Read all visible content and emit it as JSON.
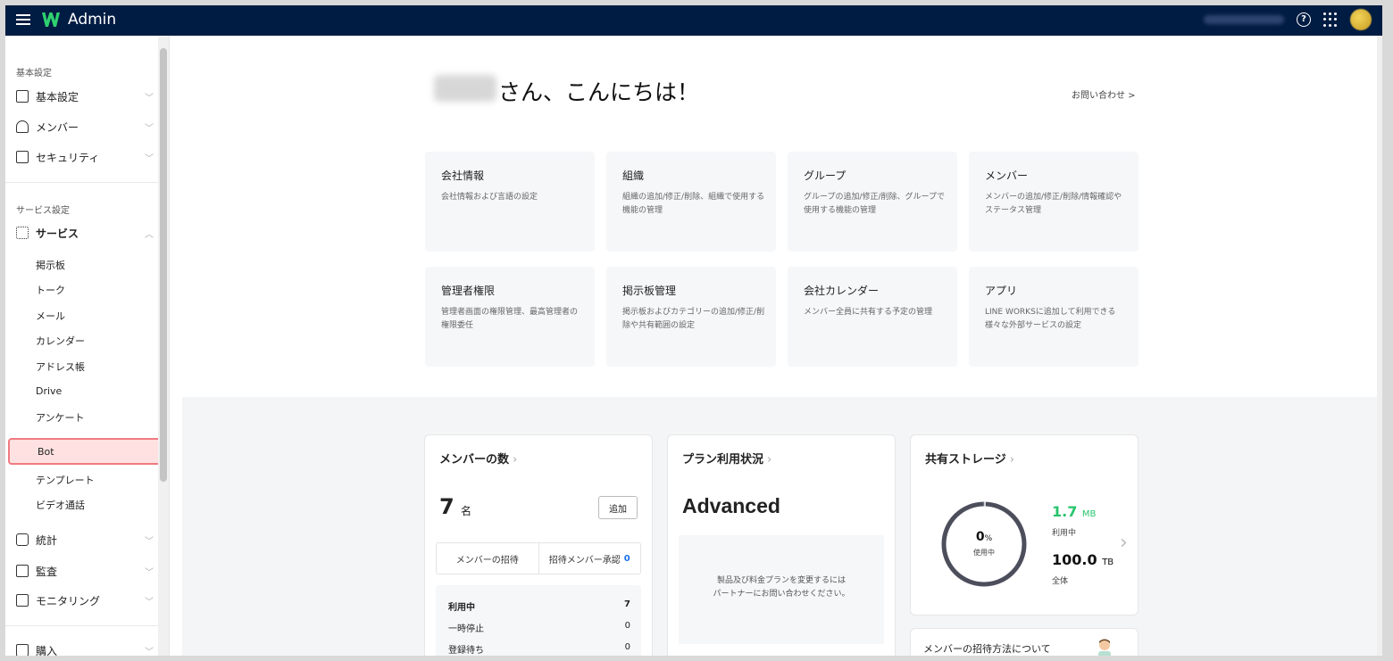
{
  "app": {
    "title": "Admin",
    "brand_color": "#001c43",
    "accent": "#27c46b",
    "highlight": "#ef7b82"
  },
  "sidebar": {
    "section_basic": "基本設定",
    "section_service": "サービス設定",
    "items": [
      {
        "label": "基本設定",
        "icon": "building-icon"
      },
      {
        "label": "メンバー",
        "icon": "members-icon"
      },
      {
        "label": "セキュリティ",
        "icon": "lock-icon"
      },
      {
        "label": "サービス",
        "icon": "apps-icon"
      },
      {
        "label": "統計",
        "icon": "chart-icon"
      },
      {
        "label": "監査",
        "icon": "audit-icon"
      },
      {
        "label": "モニタリング",
        "icon": "monitor-icon"
      },
      {
        "label": "購入",
        "icon": "wallet-icon"
      }
    ],
    "sub_items": [
      "掲示板",
      "トーク",
      "メール",
      "カレンダー",
      "アドレス帳",
      "Drive",
      "アンケート",
      "Bot",
      "テンプレート",
      "ビデオ通話"
    ],
    "active_sub": "Bot"
  },
  "main": {
    "greeting": "さん、こんにちは！",
    "contact": "お問い合わせ >",
    "cards": [
      {
        "title": "会社情報",
        "desc": "会社情報および言語の設定"
      },
      {
        "title": "組織",
        "desc": "組織の追加/修正/削除、組織で使用する機能の管理"
      },
      {
        "title": "グループ",
        "desc": "グループの追加/修正/削除、グループで使用する機能の管理"
      },
      {
        "title": "メンバー",
        "desc": "メンバーの追加/修正/削除/情報確認やステータス管理"
      },
      {
        "title": "管理者権限",
        "desc": "管理者画面の権限管理、最高管理者の権限委任"
      },
      {
        "title": "掲示板管理",
        "desc": "掲示板およびカテゴリーの追加/修正/削除や共有範囲の設定"
      },
      {
        "title": "会社カレンダー",
        "desc": "メンバー全員に共有する予定の管理"
      },
      {
        "title": "アプリ",
        "desc": "LINE WORKSに追加して利用できる様々な外部サービスの設定"
      }
    ],
    "members_panel": {
      "title": "メンバーの数",
      "count": "7",
      "unit": "名",
      "add_label": "追加",
      "invite_label": "メンバーの招待",
      "approve_label": "招待メンバー承認",
      "approve_count": "0",
      "stats": [
        {
          "label": "利用中",
          "value": "7"
        },
        {
          "label": "一時停止",
          "value": "0"
        },
        {
          "label": "登録待ち",
          "value": "0"
        }
      ]
    },
    "plan_panel": {
      "title": "プラン利用状況",
      "plan": "Advanced",
      "note_line1": "製品及び料金プランを変更するには",
      "note_line2": "パートナーにお問い合わせください。"
    },
    "storage_panel": {
      "title": "共有ストレージ",
      "percent": "0",
      "percent_unit": "%",
      "percent_label": "使用中",
      "used_value": "1.7",
      "used_unit": "MB",
      "used_label": "利用中",
      "total_value": "100.0",
      "total_unit": "TB",
      "total_label": "全体"
    },
    "invite_info": {
      "title": "メンバーの招待方法について"
    }
  }
}
